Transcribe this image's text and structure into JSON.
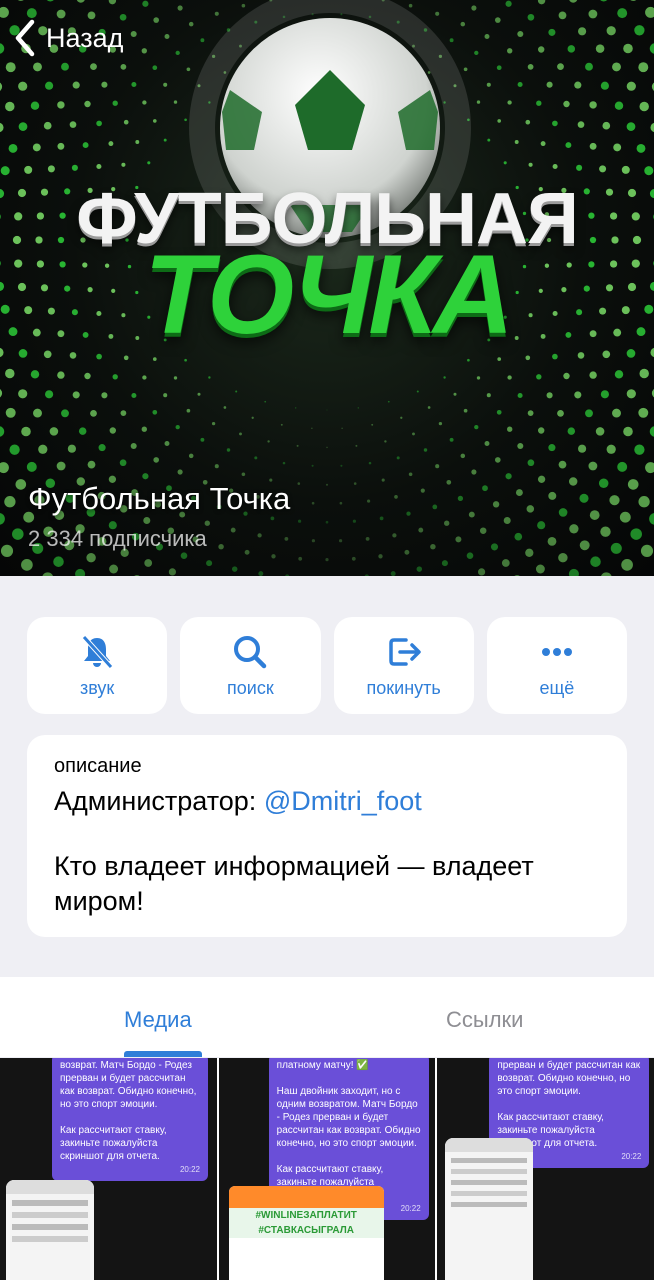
{
  "nav": {
    "back_label": "Назад"
  },
  "cover": {
    "logo_line1": "ФУТБОЛЬНАЯ",
    "logo_line2": "ТОЧКА",
    "channel_name": "Футбольная Точка",
    "subscribers": "2 334 подписчика",
    "accent_color": "#2ed23a"
  },
  "actions": [
    {
      "label": "звук",
      "icon": "bell-slash-icon"
    },
    {
      "label": "поиск",
      "icon": "search-icon"
    },
    {
      "label": "покинуть",
      "icon": "leave-icon"
    },
    {
      "label": "ещё",
      "icon": "more-icon"
    }
  ],
  "description": {
    "caption": "описание",
    "admin_prefix": "Администратор: ",
    "admin_handle": "@Dmitri_foot",
    "motto": "Кто владеет информацией — владеет миром!"
  },
  "tabs": {
    "media": "Медиа",
    "links": "Ссылки"
  },
  "media": [
    {
      "text": "возврат. Матч Бордо - Родез прерван и будет рассчитан как возврат. Обидно конечно, но это спорт эмоции.\n\nКак рассчитают ставку, закиньте пожалуйста скриншот для отчета.",
      "time": "20:22"
    },
    {
      "text": "платному матчу! ✅\n\nНаш двойник заходит, но с одним возвратом. Матч Бордо - Родез прерван и будет рассчитан как возврат. Обидно конечно, но это спорт эмоции.\n\nКак рассчитают ставку, закиньте пожалуйста скриншот для отчета.",
      "time": "20:22",
      "promo": "#WINLINEЗАПЛАТИТ",
      "promo2": "#СТАВКАСЫГРАЛА"
    },
    {
      "text": "прерван и будет рассчитан как возврат. Обидно конечно, но это спорт эмоции.\n\nКак рассчитают ставку, закиньте пожалуйста скриншот для отчета.",
      "time": "20:22"
    }
  ],
  "colors": {
    "link": "#2f7ed8",
    "background": "#efeff4"
  }
}
